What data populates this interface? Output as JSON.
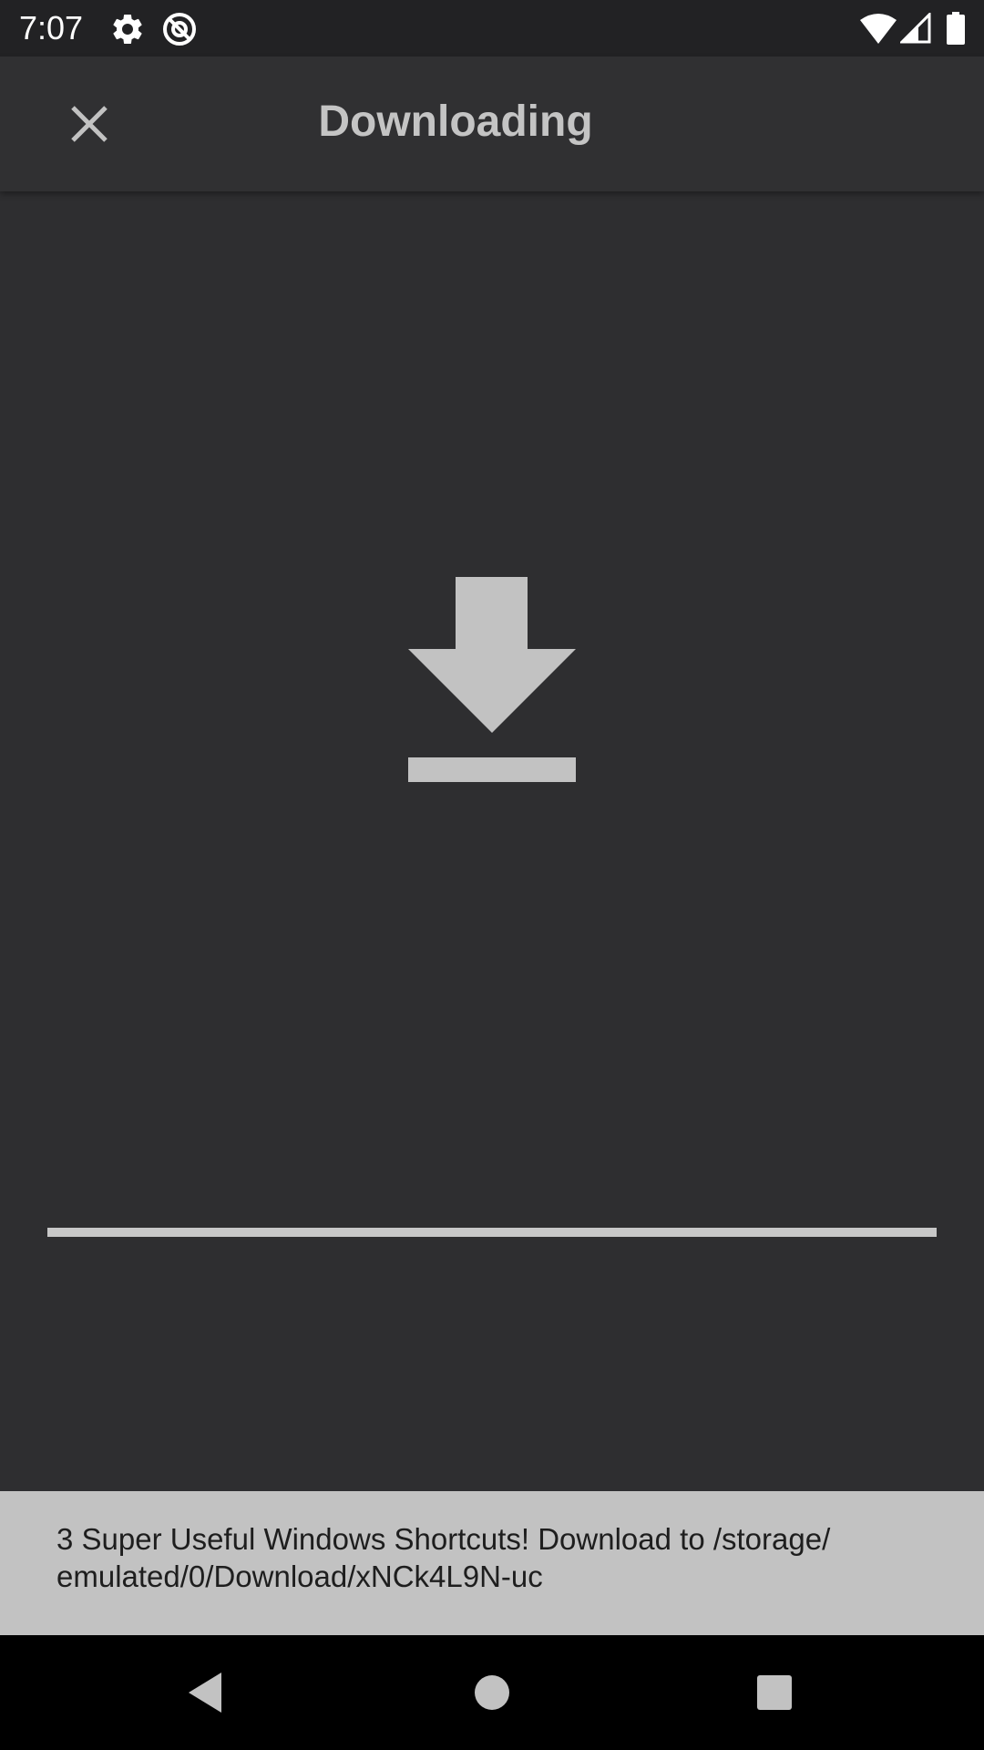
{
  "status_bar": {
    "time": "7:07",
    "icons": [
      "gear-icon",
      "at-sign-icon",
      "wifi-icon",
      "cell-signal-icon",
      "battery-icon"
    ]
  },
  "app_bar": {
    "title": "Downloading",
    "close_icon": "close-icon"
  },
  "main": {
    "graphic_icon": "download-arrow-icon",
    "progress_fraction": 1.0
  },
  "snackbar": {
    "message": "3 Super Useful Windows Shortcuts! Download to /storage/\nemulated/0/Download/xNCk4L9N-uc"
  },
  "nav_bar": {
    "icons": [
      "back-icon",
      "home-icon",
      "recents-icon"
    ]
  },
  "colors": {
    "background": "#2e2e30",
    "app_bar": "#303032",
    "status_bar": "#222224",
    "icon_gray": "#c2c2c2",
    "snackbar": "#c2c2c2"
  }
}
